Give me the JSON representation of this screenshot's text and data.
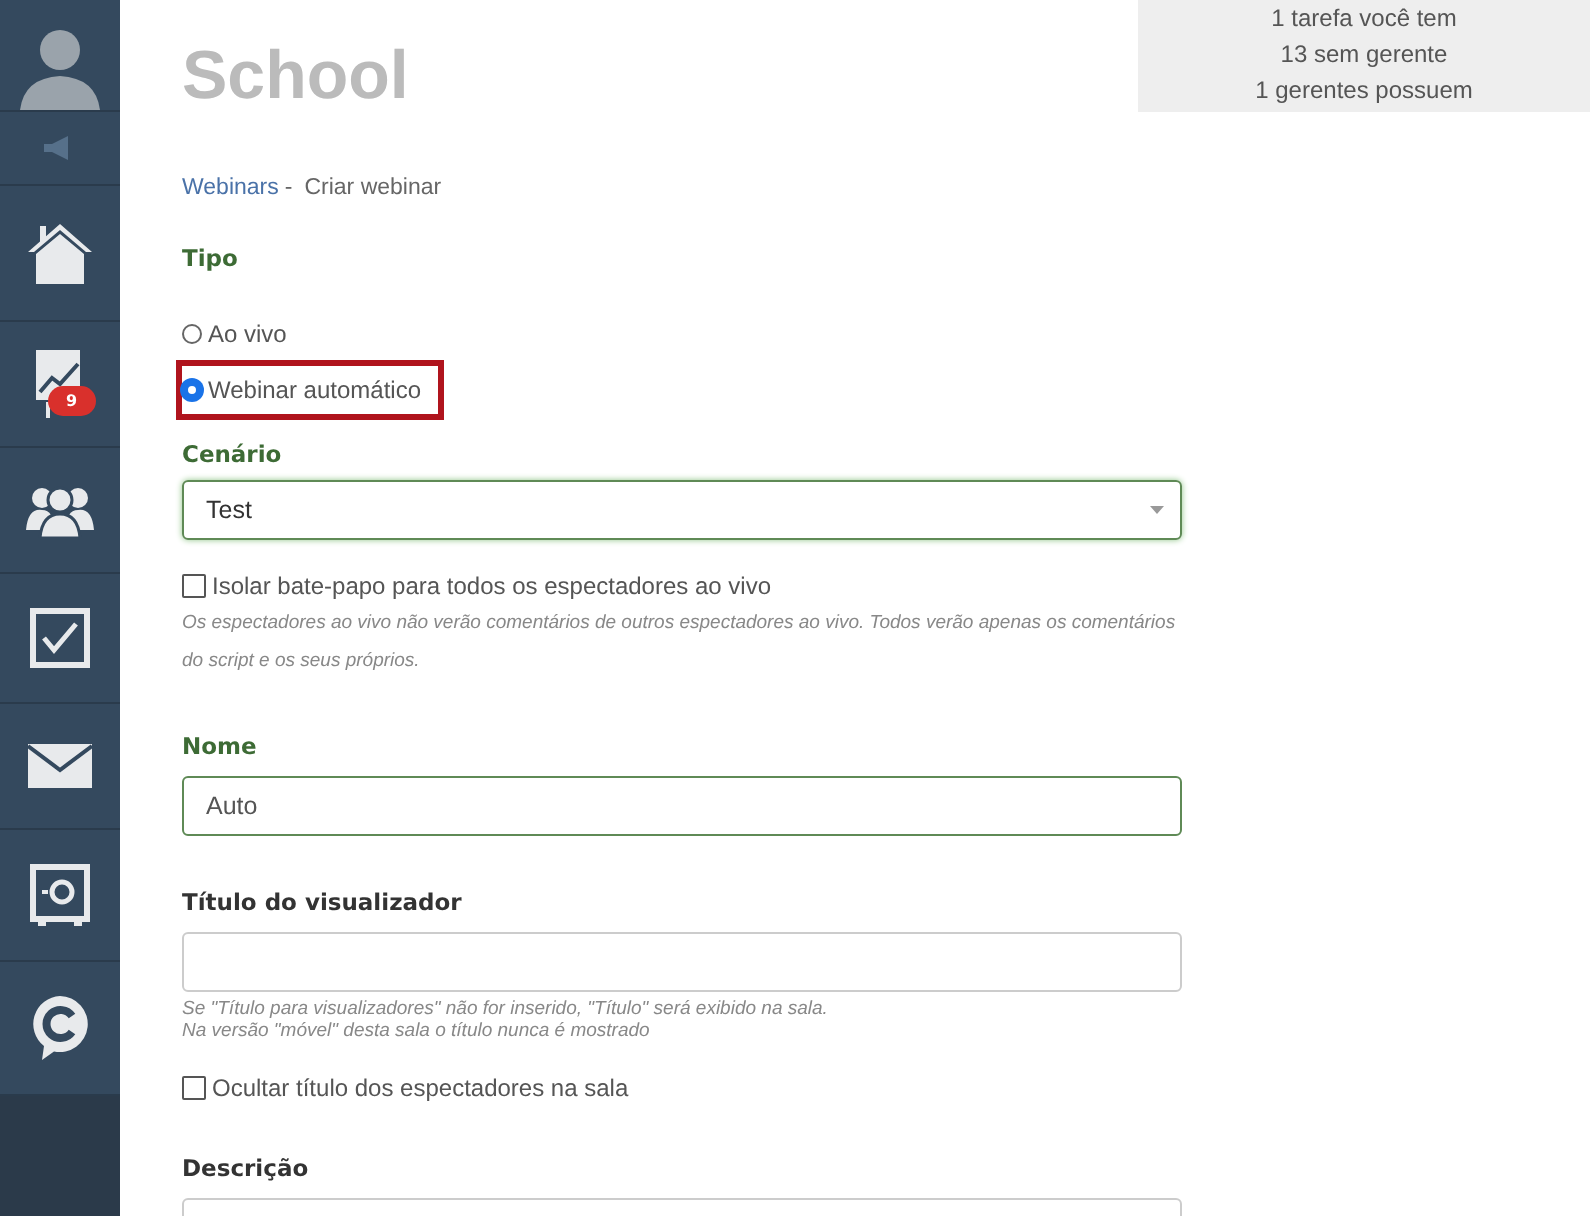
{
  "sidebar": {
    "items": [
      {
        "kind": "avatar"
      },
      {
        "kind": "speaker"
      },
      {
        "kind": "home"
      },
      {
        "kind": "chart",
        "badge": "9"
      },
      {
        "kind": "people"
      },
      {
        "kind": "check"
      },
      {
        "kind": "mail"
      },
      {
        "kind": "safe"
      },
      {
        "kind": "chat"
      }
    ]
  },
  "page_title": "School",
  "notices": [
    "1 tarefa você tem",
    "13 sem gerente",
    "1 gerentes possuem"
  ],
  "breadcrumb": {
    "link": "Webinars",
    "separator": "-",
    "current": "Criar webinar"
  },
  "tipo": {
    "label": "Tipo",
    "valid": true,
    "options": [
      {
        "label": "Ao vivo",
        "selected": false,
        "highlighted": false
      },
      {
        "label": "Webinar automático",
        "selected": true,
        "highlighted": true
      }
    ]
  },
  "cenario": {
    "label": "Cenário",
    "valid": true,
    "value": "Test"
  },
  "isolate": {
    "label": "Isolar bate-papo para todos os espectadores ao vivo",
    "checked": false,
    "hint": "Os espectadores ao vivo não verão comentários de outros espectadores ao vivo. Todos verão apenas os comentários do script e os seus próprios."
  },
  "nome": {
    "label": "Nome",
    "valid": true,
    "value": "Auto"
  },
  "titulo": {
    "label": "Título do visualizador",
    "valid": false,
    "hint_lines": [
      "Se \"Título para visualizadores\" não for inserido, \"Título\" será exibido na sala.",
      "Na versão \"móvel\" desta sala o título nunca é mostrado"
    ]
  },
  "hide_title": {
    "label": "Ocultar título dos espectadores na sala",
    "checked": false
  },
  "descricao": {
    "label": "Descrição",
    "valid": false
  }
}
